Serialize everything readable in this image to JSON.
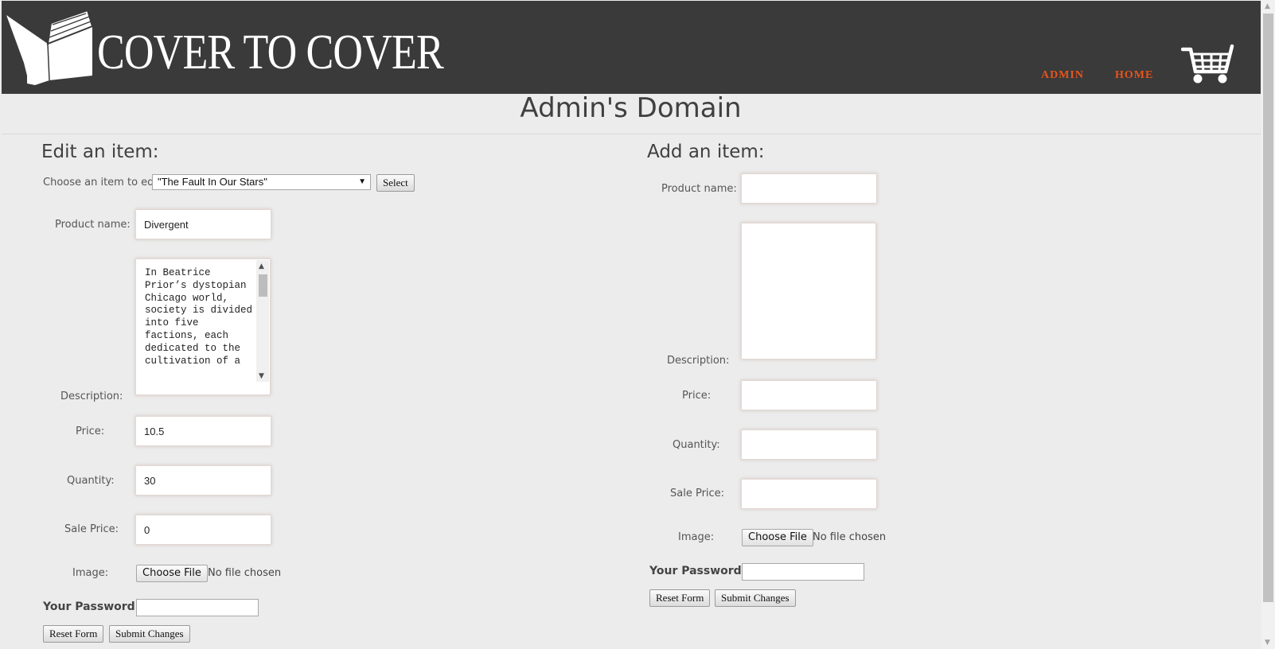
{
  "header": {
    "brand": "COVER TO COVER",
    "nav": {
      "admin": "ADMIN",
      "home": "HOME"
    },
    "cart_icon": "shopping-cart-icon",
    "logo_icon": "open-book-icon"
  },
  "page_title": "Admin's Domain",
  "edit": {
    "title": "Edit an item:",
    "choose_label": "Choose an item to edit:",
    "selected_item": "\"The Fault In Our Stars\"",
    "select_button": "Select",
    "product_name_label": "Product name:",
    "product_name_value": "Divergent",
    "description_label": "Description:",
    "description_value": "In Beatrice Prior’s dystopian Chicago world, society is divided into five factions, each dedicated to the cultivation of a",
    "price_label": "Price:",
    "price_value": "10.5",
    "quantity_label": "Quantity:",
    "quantity_value": "30",
    "sale_price_label": "Sale Price:",
    "sale_price_value": "0",
    "image_label": "Image:",
    "choose_file": "Choose File",
    "no_file": "No file chosen",
    "password_label": "Your Password:",
    "reset_button": "Reset Form",
    "submit_button": "Submit Changes"
  },
  "add": {
    "title": "Add an item:",
    "product_name_label": "Product name:",
    "description_label": "Description:",
    "price_label": "Price:",
    "quantity_label": "Quantity:",
    "sale_price_label": "Sale Price:",
    "image_label": "Image:",
    "choose_file": "Choose File",
    "no_file": "No file chosen",
    "password_label": "Your Password:",
    "reset_button": "Reset Form",
    "submit_button": "Submit Changes"
  },
  "colors": {
    "header_bg": "#3a3a3a",
    "nav_accent": "#e8541a",
    "page_bg": "#ececec"
  }
}
